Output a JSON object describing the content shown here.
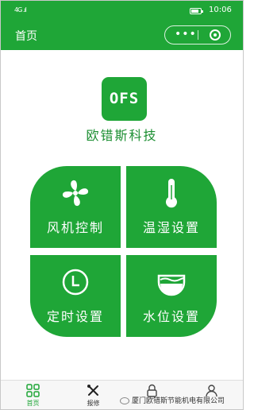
{
  "status_bar": {
    "signal": "4G .ıl",
    "time": "10:06"
  },
  "nav": {
    "title": "首页",
    "more_icon": "•••",
    "close_icon": "target-circle-icon"
  },
  "brand": {
    "logo_text": "OFS",
    "name": "欧错斯科技"
  },
  "tiles": [
    {
      "label": "风机控制",
      "icon": "fan-icon"
    },
    {
      "label": "温湿设置",
      "icon": "thermometer-icon"
    },
    {
      "label": "定时设置",
      "icon": "clock-icon"
    },
    {
      "label": "水位设置",
      "icon": "water-level-icon"
    }
  ],
  "tabbar": {
    "items": [
      {
        "label": "首页",
        "icon": "grid-icon",
        "active": true
      },
      {
        "label": "报修",
        "icon": "wrench-icon",
        "active": false
      },
      {
        "label": "",
        "icon": "lock-icon",
        "active": false
      },
      {
        "label": "",
        "icon": "user-icon",
        "active": false
      }
    ]
  },
  "watermark": {
    "text": "厦门欧错斯节能机电有限公司"
  },
  "colors": {
    "primary": "#1fa637",
    "brand_text": "#1c8f32"
  }
}
